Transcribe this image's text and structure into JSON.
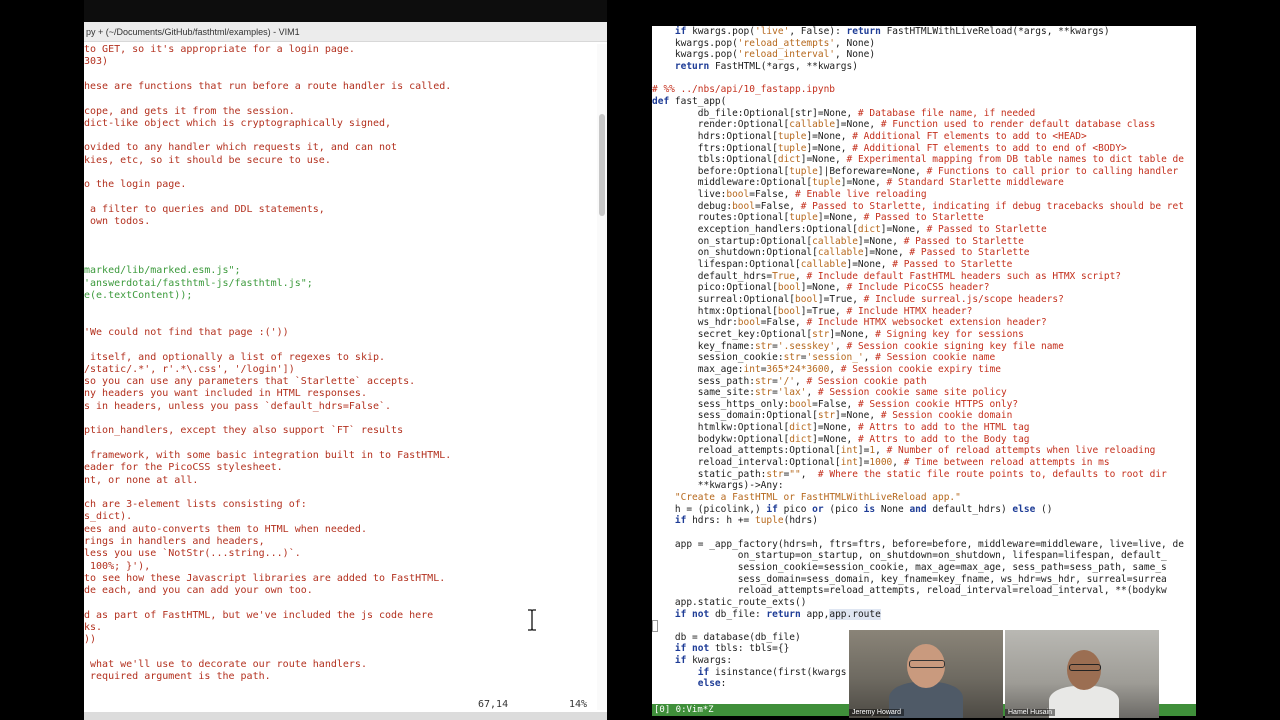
{
  "left_window": {
    "title": "py + (~/Documents/GitHub/fasthtml/examples) - VIM1",
    "lines": [
      {
        "text": "to GET, so it's appropriate for a login page.",
        "color": "red"
      },
      {
        "text": "303)",
        "color": "red"
      },
      {
        "text": "",
        "color": "red"
      },
      {
        "text": "hese are functions that run before a route handler is called.",
        "color": "red"
      },
      {
        "text": "",
        "color": "red"
      },
      {
        "text": "cope, and gets it from the session.",
        "color": "red"
      },
      {
        "text": "dict-like object which is cryptographically signed,",
        "color": "red"
      },
      {
        "text": "",
        "color": "red"
      },
      {
        "text": "ovided to any handler which requests it, and can not",
        "color": "red"
      },
      {
        "text": "kies, etc, so it should be secure to use.",
        "color": "red"
      },
      {
        "text": "",
        "color": "red"
      },
      {
        "text": "o the login page.",
        "color": "red"
      },
      {
        "text": "",
        "color": "red"
      },
      {
        "text": " a filter to queries and DDL statements,",
        "color": "red"
      },
      {
        "text": " own todos.",
        "color": "red"
      },
      {
        "text": "",
        "color": "red"
      },
      {
        "text": "",
        "color": "red"
      },
      {
        "text": "",
        "color": "red"
      },
      {
        "text": "marked/lib/marked.esm.js\";",
        "color": "green"
      },
      {
        "text": "'answerdotai/fasthtml-js/fasthtml.js\";",
        "color": "green"
      },
      {
        "text": "e(e.textContent));",
        "color": "green"
      },
      {
        "text": "",
        "color": "red"
      },
      {
        "text": "",
        "color": "red"
      },
      {
        "text": "'We could not find that page :('))",
        "color": "red"
      },
      {
        "text": "",
        "color": "red"
      },
      {
        "text": " itself, and optionally a list of regexes to skip.",
        "color": "red"
      },
      {
        "text": "/static/.*', r'.*\\.css', '/login'])",
        "color": "red"
      },
      {
        "text": "so you can use any parameters that `Starlette` accepts.",
        "color": "red"
      },
      {
        "text": "ny headers you want included in HTML responses.",
        "color": "red"
      },
      {
        "text": "s in headers, unless you pass `default_hdrs=False`.",
        "color": "red"
      },
      {
        "text": "",
        "color": "red"
      },
      {
        "text": "ption_handlers, except they also support `FT` results",
        "color": "red"
      },
      {
        "text": "",
        "color": "red"
      },
      {
        "text": " framework, with some basic integration built in to FastHTML.",
        "color": "red"
      },
      {
        "text": "eader for the PicoCSS stylesheet.",
        "color": "red"
      },
      {
        "text": "nt, or none at all.",
        "color": "red"
      },
      {
        "text": "",
        "color": "red"
      },
      {
        "text": "ch are 3-element lists consisting of:",
        "color": "red"
      },
      {
        "text": "s_dict).",
        "color": "red"
      },
      {
        "text": "ees and auto-converts them to HTML when needed.",
        "color": "red"
      },
      {
        "text": "rings in handlers and headers,",
        "color": "red"
      },
      {
        "text": "less you use `NotStr(...string...)`.",
        "color": "red"
      },
      {
        "text": " 100%; }'),",
        "color": "red"
      },
      {
        "text": "to see how these Javascript libraries are added to FastHTML.",
        "color": "red"
      },
      {
        "text": "de each, and you can add your own too.",
        "color": "red"
      },
      {
        "text": "",
        "color": "red"
      },
      {
        "text": "d as part of FastHTML, but we've included the js code here",
        "color": "red"
      },
      {
        "text": "ks.",
        "color": "red"
      },
      {
        "text": "))",
        "color": "red"
      },
      {
        "text": "",
        "color": "red"
      },
      {
        "text": " what we'll use to decorate our route handlers.",
        "color": "red"
      },
      {
        "text": " required argument is the path.",
        "color": "red"
      }
    ],
    "status_position": "67,14",
    "status_percent": "14%"
  },
  "right_pane": {
    "lines": [
      [
        [
          "    ",
          "fn"
        ],
        [
          "if",
          "kw"
        ],
        [
          " kwargs.pop(",
          "fn"
        ],
        [
          "'live'",
          "st"
        ],
        [
          ", False): ",
          "fn"
        ],
        [
          "return",
          "kw"
        ],
        [
          " FastHTMLWithLiveReload(*args, **kwargs)",
          "fn"
        ]
      ],
      [
        [
          "    kwargs.pop(",
          "fn"
        ],
        [
          "'reload_attempts'",
          "st"
        ],
        [
          ", None)",
          "fn"
        ]
      ],
      [
        [
          "    kwargs.pop(",
          "fn"
        ],
        [
          "'reload_interval'",
          "st"
        ],
        [
          ", None)",
          "fn"
        ]
      ],
      [
        [
          "    ",
          "fn"
        ],
        [
          "return",
          "kw"
        ],
        [
          " FastHTML(*args, **kwargs)",
          "fn"
        ]
      ],
      [],
      [
        [
          "# %% ../nbs/api/10_fastapp.ipynb",
          "cm"
        ]
      ],
      [
        [
          "def",
          "kw"
        ],
        [
          " fast_app(",
          "fn"
        ]
      ],
      [
        [
          "        db_file:Optional[str]=None, ",
          "fn"
        ],
        [
          "# Database file name, if needed",
          "cm"
        ]
      ],
      [
        [
          "        render:Optional[",
          "fn"
        ],
        [
          "callable",
          "st"
        ],
        [
          "]=None, ",
          "fn"
        ],
        [
          "# Function used to render default database class",
          "cm"
        ]
      ],
      [
        [
          "        hdrs:Optional[",
          "fn"
        ],
        [
          "tuple",
          "st"
        ],
        [
          "]=None, ",
          "fn"
        ],
        [
          "# Additional FT elements to add to <HEAD>",
          "cm"
        ]
      ],
      [
        [
          "        ftrs:Optional[",
          "fn"
        ],
        [
          "tuple",
          "st"
        ],
        [
          "]=None, ",
          "fn"
        ],
        [
          "# Additional FT elements to add to end of <BODY>",
          "cm"
        ]
      ],
      [
        [
          "        tbls:Optional[",
          "fn"
        ],
        [
          "dict",
          "st"
        ],
        [
          "]=None, ",
          "fn"
        ],
        [
          "# Experimental mapping from DB table names to dict table de",
          "cm"
        ]
      ],
      [
        [
          "        before:Optional[",
          "fn"
        ],
        [
          "tuple",
          "st"
        ],
        [
          "]|Beforeware=None, ",
          "fn"
        ],
        [
          "# Functions to call prior to calling handler",
          "cm"
        ]
      ],
      [
        [
          "        middleware:Optional[",
          "fn"
        ],
        [
          "tuple",
          "st"
        ],
        [
          "]=None, ",
          "fn"
        ],
        [
          "# Standard Starlette middleware",
          "cm"
        ]
      ],
      [
        [
          "        live:",
          "fn"
        ],
        [
          "bool",
          "st"
        ],
        [
          "=False, ",
          "fn"
        ],
        [
          "# Enable live reloading",
          "cm"
        ]
      ],
      [
        [
          "        debug:",
          "fn"
        ],
        [
          "bool",
          "st"
        ],
        [
          "=False, ",
          "fn"
        ],
        [
          "# Passed to Starlette, indicating if debug tracebacks should be ret",
          "cm"
        ]
      ],
      [
        [
          "        routes:Optional[",
          "fn"
        ],
        [
          "tuple",
          "st"
        ],
        [
          "]=None, ",
          "fn"
        ],
        [
          "# Passed to Starlette",
          "cm"
        ]
      ],
      [
        [
          "        exception_handlers:Optional[",
          "fn"
        ],
        [
          "dict",
          "st"
        ],
        [
          "]=None, ",
          "fn"
        ],
        [
          "# Passed to Starlette",
          "cm"
        ]
      ],
      [
        [
          "        on_startup:Optional[",
          "fn"
        ],
        [
          "callable",
          "st"
        ],
        [
          "]=None, ",
          "fn"
        ],
        [
          "# Passed to Starlette",
          "cm"
        ]
      ],
      [
        [
          "        on_shutdown:Optional[",
          "fn"
        ],
        [
          "callable",
          "st"
        ],
        [
          "]=None, ",
          "fn"
        ],
        [
          "# Passed to Starlette",
          "cm"
        ]
      ],
      [
        [
          "        lifespan:Optional[",
          "fn"
        ],
        [
          "callable",
          "st"
        ],
        [
          "]=None, ",
          "fn"
        ],
        [
          "# Passed to Starlette",
          "cm"
        ]
      ],
      [
        [
          "        default_hdrs=",
          "fn"
        ],
        [
          "True",
          "st"
        ],
        [
          ", ",
          "fn"
        ],
        [
          "# Include default FastHTML headers such as HTMX script?",
          "cm"
        ]
      ],
      [
        [
          "        pico:Optional[",
          "fn"
        ],
        [
          "bool",
          "st"
        ],
        [
          "]=None, ",
          "fn"
        ],
        [
          "# Include PicoCSS header?",
          "cm"
        ]
      ],
      [
        [
          "        surreal:Optional[",
          "fn"
        ],
        [
          "bool",
          "st"
        ],
        [
          "]=True, ",
          "fn"
        ],
        [
          "# Include surreal.js/scope headers?",
          "cm"
        ]
      ],
      [
        [
          "        htmx:Optional[",
          "fn"
        ],
        [
          "bool",
          "st"
        ],
        [
          "]=True, ",
          "fn"
        ],
        [
          "# Include HTMX header?",
          "cm"
        ]
      ],
      [
        [
          "        ws_hdr:",
          "fn"
        ],
        [
          "bool",
          "st"
        ],
        [
          "=False, ",
          "fn"
        ],
        [
          "# Include HTMX websocket extension header?",
          "cm"
        ]
      ],
      [
        [
          "        secret_key:Optional[",
          "fn"
        ],
        [
          "str",
          "st"
        ],
        [
          "]=None, ",
          "fn"
        ],
        [
          "# Signing key for sessions",
          "cm"
        ]
      ],
      [
        [
          "        key_fname:",
          "fn"
        ],
        [
          "str",
          "st"
        ],
        [
          "=",
          "fn"
        ],
        [
          "'.sesskey'",
          "st"
        ],
        [
          ", ",
          "fn"
        ],
        [
          "# Session cookie signing key file name",
          "cm"
        ]
      ],
      [
        [
          "        session_cookie:",
          "fn"
        ],
        [
          "str",
          "st"
        ],
        [
          "=",
          "fn"
        ],
        [
          "'session_'",
          "st"
        ],
        [
          ", ",
          "fn"
        ],
        [
          "# Session cookie name",
          "cm"
        ]
      ],
      [
        [
          "        max_age:",
          "fn"
        ],
        [
          "int",
          "st"
        ],
        [
          "=",
          "fn"
        ],
        [
          "365*24*3600",
          "st"
        ],
        [
          ", ",
          "fn"
        ],
        [
          "# Session cookie expiry time",
          "cm"
        ]
      ],
      [
        [
          "        sess_path:",
          "fn"
        ],
        [
          "str",
          "st"
        ],
        [
          "=",
          "fn"
        ],
        [
          "'/'",
          "st"
        ],
        [
          ", ",
          "fn"
        ],
        [
          "# Session cookie path",
          "cm"
        ]
      ],
      [
        [
          "        same_site:",
          "fn"
        ],
        [
          "str",
          "st"
        ],
        [
          "=",
          "fn"
        ],
        [
          "'lax'",
          "st"
        ],
        [
          ", ",
          "fn"
        ],
        [
          "# Session cookie same site policy",
          "cm"
        ]
      ],
      [
        [
          "        sess_https_only:",
          "fn"
        ],
        [
          "bool",
          "st"
        ],
        [
          "=False, ",
          "fn"
        ],
        [
          "# Session cookie HTTPS only?",
          "cm"
        ]
      ],
      [
        [
          "        sess_domain:Optional[",
          "fn"
        ],
        [
          "str",
          "st"
        ],
        [
          "]=None, ",
          "fn"
        ],
        [
          "# Session cookie domain",
          "cm"
        ]
      ],
      [
        [
          "        htmlkw:Optional[",
          "fn"
        ],
        [
          "dict",
          "st"
        ],
        [
          "]=None, ",
          "fn"
        ],
        [
          "# Attrs to add to the HTML tag",
          "cm"
        ]
      ],
      [
        [
          "        bodykw:Optional[",
          "fn"
        ],
        [
          "dict",
          "st"
        ],
        [
          "]=None, ",
          "fn"
        ],
        [
          "# Attrs to add to the Body tag",
          "cm"
        ]
      ],
      [
        [
          "        reload_attempts:Optional[",
          "fn"
        ],
        [
          "int",
          "st"
        ],
        [
          "]=",
          "fn"
        ],
        [
          "1",
          "st"
        ],
        [
          ", ",
          "fn"
        ],
        [
          "# Number of reload attempts when live reloading",
          "cm"
        ]
      ],
      [
        [
          "        reload_interval:Optional[",
          "fn"
        ],
        [
          "int",
          "st"
        ],
        [
          "]=",
          "fn"
        ],
        [
          "1000",
          "st"
        ],
        [
          ", ",
          "fn"
        ],
        [
          "# Time between reload attempts in ms",
          "cm"
        ]
      ],
      [
        [
          "        static_path:",
          "fn"
        ],
        [
          "str",
          "st"
        ],
        [
          "=",
          "fn"
        ],
        [
          "\"\"",
          "st"
        ],
        [
          ",  ",
          "fn"
        ],
        [
          "# Where the static file route points to, defaults to root dir",
          "cm"
        ]
      ],
      [
        [
          "        **kwargs)->Any:",
          "fn"
        ]
      ],
      [
        [
          "    ",
          "fn"
        ],
        [
          "\"Create a FastHTML or FastHTMLWithLiveReload app.\"",
          "st"
        ]
      ],
      [
        [
          "    h = (picolink,) ",
          "fn"
        ],
        [
          "if",
          "kw"
        ],
        [
          " pico ",
          "fn"
        ],
        [
          "or",
          "kw"
        ],
        [
          " (pico ",
          "fn"
        ],
        [
          "is",
          "kw"
        ],
        [
          " None ",
          "fn"
        ],
        [
          "and",
          "kw"
        ],
        [
          " default_hdrs) ",
          "fn"
        ],
        [
          "else",
          "kw"
        ],
        [
          " ()",
          "fn"
        ]
      ],
      [
        [
          "    ",
          "fn"
        ],
        [
          "if",
          "kw"
        ],
        [
          " hdrs: h += ",
          "fn"
        ],
        [
          "tuple",
          "st"
        ],
        [
          "(hdrs)",
          "fn"
        ]
      ],
      [],
      [
        [
          "    app = _app_factory(hdrs=h, ftrs=ftrs, before=before, middleware=middleware, live=live, de",
          "fn"
        ]
      ],
      [
        [
          "               on_startup=on_startup, on_shutdown=on_shutdown, lifespan=lifespan, default_",
          "fn"
        ]
      ],
      [
        [
          "               session_cookie=session_cookie, max_age=max_age, sess_path=sess_path, same_s",
          "fn"
        ]
      ],
      [
        [
          "               sess_domain=sess_domain, key_fname=key_fname, ws_hdr=ws_hdr, surreal=surrea",
          "fn"
        ]
      ],
      [
        [
          "               reload_attempts=reload_attempts, reload_interval=reload_interval, **(bodykw",
          "fn"
        ]
      ],
      [
        [
          "    app.static_route_exts()",
          "fn"
        ]
      ],
      [
        [
          "    ",
          "fn"
        ],
        [
          "if not",
          "kw"
        ],
        [
          " db_file: ",
          "fn"
        ],
        [
          "return",
          "kw"
        ],
        [
          " app,",
          "fn"
        ],
        [
          "app.route",
          "hl"
        ]
      ],
      [],
      [
        [
          "    db = database(db_file)",
          "fn"
        ]
      ],
      [
        [
          "    ",
          "fn"
        ],
        [
          "if not",
          "kw"
        ],
        [
          " tbls: tbls={}",
          "fn"
        ]
      ],
      [
        [
          "    ",
          "fn"
        ],
        [
          "if",
          "kw"
        ],
        [
          " kwargs:",
          "fn"
        ]
      ],
      [
        [
          "        ",
          "fn"
        ],
        [
          "if",
          "kw"
        ],
        [
          " isinstance(first(kwargs",
          "fn"
        ]
      ],
      [
        [
          "        ",
          "fn"
        ],
        [
          "else",
          "kw"
        ],
        [
          ":",
          "fn"
        ]
      ]
    ]
  },
  "tmux_status": "[0] 0:Vim*Z",
  "participants": [
    {
      "name": "Jeremy Howard"
    },
    {
      "name": "Hamel Husain"
    }
  ]
}
